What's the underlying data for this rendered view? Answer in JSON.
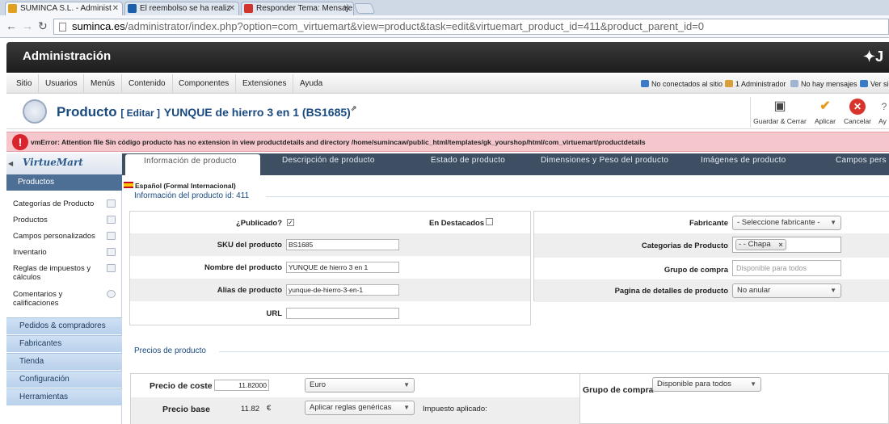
{
  "browser": {
    "tabs": [
      {
        "label": "SUMINCA S.L. - Administ",
        "fav_color": "#e0a020"
      },
      {
        "label": "El reembolso se ha realiz",
        "fav_color": "#1b5fa8"
      },
      {
        "label": "Responder Tema: Mensaje",
        "fav_color": "#d0342c"
      }
    ],
    "url_host": "suminca.es",
    "url_path": "/administrator/index.php?option=com_virtuemart&view=product&task=edit&virtuemart_product_id=411&product_parent_id=0"
  },
  "header": {
    "title": "Administración",
    "logo_letter": "J"
  },
  "menu": {
    "items": [
      "Sitio",
      "Usuarios",
      "Menús",
      "Contenido",
      "Componentes",
      "Extensiones",
      "Ayuda"
    ],
    "status": [
      "No conectados al sitio",
      "1 Administrador",
      "No hay mensajes",
      "Ver si"
    ]
  },
  "title": {
    "heading": "Producto",
    "edit": "[ Editar ]",
    "name": "YUNQUE de hierro 3 en 1 (BS1685)"
  },
  "toolbar": {
    "save_close": "Guardar & Cerrar",
    "apply": "Aplicar",
    "cancel": "Cancelar",
    "help": "Ay"
  },
  "error": {
    "message": "vmError: Attention file Sin código producto has no extension in view productdetails and directory /home/sumincaw/public_html/templates/gk_yourshop/html/com_virtuemart/productdetails"
  },
  "sidebar": {
    "logo": "VirtueMart",
    "section": "Productos",
    "items": [
      "Categorías de Producto",
      "Productos",
      "Campos personalizados",
      "Inventario",
      "Reglas de impuestos y cálculos",
      "Comentarios y calificaciones"
    ],
    "groups": [
      "Pedidos & compradores",
      "Fabricantes",
      "Tienda",
      "Configuración",
      "Herramientas"
    ]
  },
  "tabs": [
    "Información de producto",
    "Descripción de producto",
    "Estado de producto",
    "Dimensiones y Peso del producto",
    "Imágenes de producto",
    "Campos pers"
  ],
  "product": {
    "language": "Español (Formal Internacional)",
    "legend": "Información del producto id: 411",
    "published_label": "¿Publicado?",
    "published": true,
    "featured_label": "En Destacados",
    "featured": false,
    "sku_label": "SKU del producto",
    "sku": "BS1685",
    "name_label": "Nombre del producto",
    "name": "YUNQUE de hierro 3 en 1",
    "alias_label": "Alias de producto",
    "alias": "yunque-de-hierro-3-en-1",
    "url_label": "URL",
    "url": "",
    "manufacturer_label": "Fabricante",
    "manufacturer": "- Seleccione fabricante -",
    "categories_label": "Categorias de Producto",
    "category_chip": "- - Chapa",
    "shopper_group_label": "Grupo de compra",
    "shopper_group_placeholder": "Disponible para todos",
    "page_details_label": "Pagina de detalles de producto",
    "page_details": "No anular"
  },
  "prices": {
    "legend": "Precios de producto",
    "cost_label": "Precio de coste",
    "cost": "11.82000",
    "currency": "Euro",
    "base_label": "Precio base",
    "base": "11.82",
    "base_currency_symbol": "€",
    "rules": "Aplicar reglas genéricas",
    "tax_applied_label": "Impuesto aplicado:",
    "group_label": "Grupo de compra",
    "group": "Disponible para todos"
  }
}
